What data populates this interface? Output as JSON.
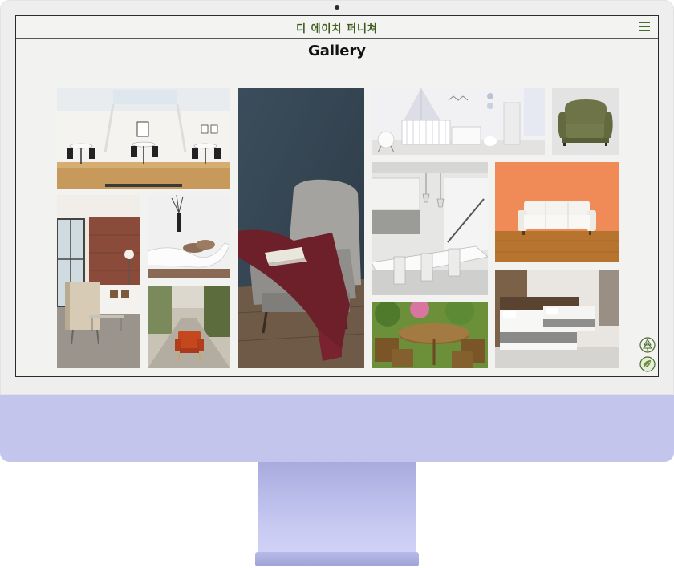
{
  "site": {
    "logo_text": "디 에이치 퍼니쳐",
    "page_title": "Gallery"
  },
  "icons": {
    "menu": "hamburger-menu-icon",
    "float_top": "tree-logo-icon",
    "float_bottom": "leaf-badge-icon"
  },
  "colors": {
    "accent": "#4a6a2a",
    "logo": "#3d5a1f",
    "chin": "#c3c5ec"
  },
  "gallery": [
    {
      "name": "gallery-photo-cafe-interior",
      "subject": "bright cafe with round white tables"
    },
    {
      "name": "gallery-photo-grey-wingback-chair",
      "subject": "grey wingback armchair with red throw"
    },
    {
      "name": "gallery-photo-nursery-room",
      "subject": "white nursery room with crib"
    },
    {
      "name": "gallery-photo-green-armchair",
      "subject": "olive green armchair"
    },
    {
      "name": "gallery-photo-living-room",
      "subject": "living room with sofa and brick wall"
    },
    {
      "name": "gallery-photo-white-lounge-chair",
      "subject": "white chaise lounge with vase"
    },
    {
      "name": "gallery-photo-orange-chair-street",
      "subject": "orange armchair on a street"
    },
    {
      "name": "gallery-photo-modern-kitchen",
      "subject": "modern white kitchen"
    },
    {
      "name": "gallery-photo-white-sofa",
      "subject": "white sofa against orange wall"
    },
    {
      "name": "gallery-photo-garden-furniture",
      "subject": "wooden garden table set"
    },
    {
      "name": "gallery-photo-hotel-bedroom",
      "subject": "hotel room with twin beds"
    }
  ]
}
